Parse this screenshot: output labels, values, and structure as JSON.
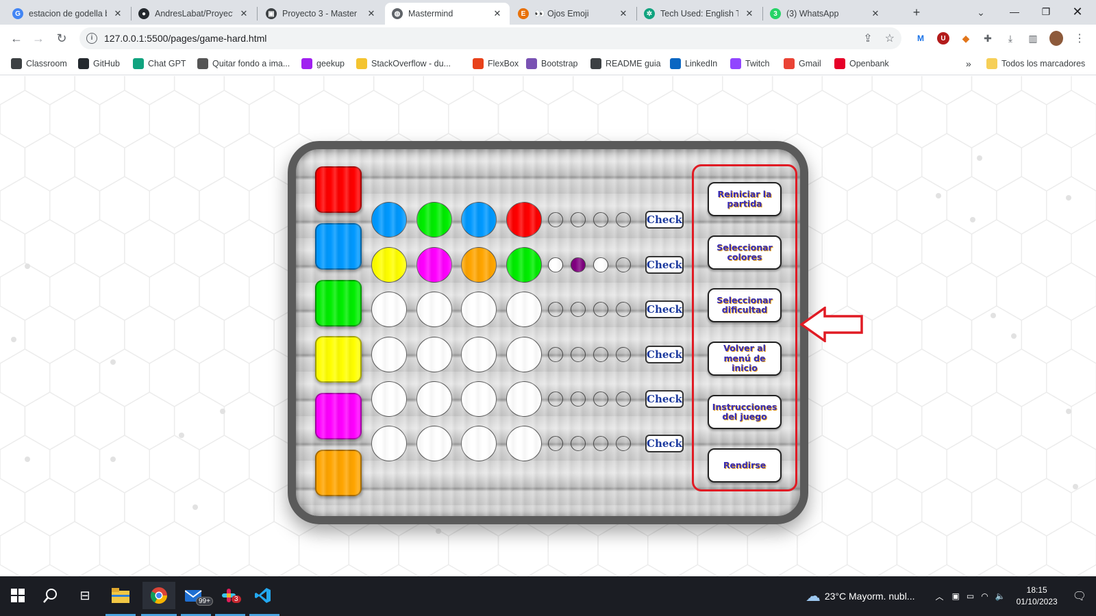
{
  "browser": {
    "tabs": [
      {
        "label": "estacion de godella b",
        "favicon": "google-icon",
        "color": "#4285f4",
        "glyph": "G"
      },
      {
        "label": "AndresLabat/Proyect",
        "favicon": "github-icon",
        "color": "#24292e",
        "glyph": "●"
      },
      {
        "label": "Proyecto 3 - Master",
        "favicon": "slides-icon",
        "color": "#3c4043",
        "glyph": "▣"
      },
      {
        "label": "Mastermind",
        "favicon": "globe-icon",
        "color": "#5f6368",
        "glyph": "◍"
      },
      {
        "label": "👀 Ojos Emoji",
        "favicon": "emojipedia-icon",
        "color": "#e8710a",
        "glyph": "E"
      },
      {
        "label": "Tech Used: English Tr",
        "favicon": "chatgpt-icon",
        "color": "#10a37f",
        "glyph": "✲"
      },
      {
        "label": "(3) WhatsApp",
        "favicon": "whatsapp-icon",
        "color": "#25d366",
        "glyph": "3"
      }
    ],
    "active_tab": 3,
    "url": "127.0.0.1:5500/pages/game-hard.html"
  },
  "bookmarks": [
    {
      "label": "Classroom",
      "icon": "classroom-icon",
      "color": "#3c4043"
    },
    {
      "label": "GitHub",
      "icon": "github-icon",
      "color": "#24292e"
    },
    {
      "label": "Chat GPT",
      "icon": "chatgpt-icon",
      "color": "#10a37f"
    },
    {
      "label": "Quitar fondo a ima...",
      "icon": "removebg-icon",
      "color": "#555555"
    },
    {
      "label": "geekup",
      "icon": "geekup-icon",
      "color": "#a020f0"
    },
    {
      "label": "StackOverflow - du...",
      "icon": "stackoverflow-icon",
      "color": "#f4c430"
    },
    {
      "label": "FlexBox",
      "icon": "flexbox-icon",
      "color": "#e8411a"
    },
    {
      "label": "Bootstrap",
      "icon": "bootstrap-icon",
      "color": "#7952b3"
    },
    {
      "label": "README guia",
      "icon": "markdown-icon",
      "color": "#3c4043"
    },
    {
      "label": "LinkedIn",
      "icon": "linkedin-icon",
      "color": "#0a66c2"
    },
    {
      "label": "Twitch",
      "icon": "twitch-icon",
      "color": "#9146ff"
    },
    {
      "label": "Gmail",
      "icon": "gmail-icon",
      "color": "#ea4335"
    },
    {
      "label": "Openbank",
      "icon": "openbank-icon",
      "color": "#e60028"
    }
  ],
  "bookmarks_overflow": "»",
  "bookmarks_folder": "Todos los marcadores",
  "game": {
    "palette": [
      "#ff0000",
      "#0099ff",
      "#00ee00",
      "#ffff00",
      "#ff00ff",
      "#ffa500"
    ],
    "rows": [
      {
        "pegs": [
          "#0099ff",
          "#00ee00",
          "#0099ff",
          "#ff0000"
        ],
        "keys": [
          "empty",
          "empty",
          "empty",
          "empty"
        ]
      },
      {
        "pegs": [
          "#ffff00",
          "#ff00ff",
          "#ffa500",
          "#00ee00"
        ],
        "keys": [
          "#ffffff",
          "#800080",
          "#ffffff",
          "empty"
        ]
      },
      {
        "pegs": [
          "#ffffff",
          "#ffffff",
          "#ffffff",
          "#ffffff"
        ],
        "keys": [
          "empty",
          "empty",
          "empty",
          "empty"
        ]
      },
      {
        "pegs": [
          "#ffffff",
          "#ffffff",
          "#ffffff",
          "#ffffff"
        ],
        "keys": [
          "empty",
          "empty",
          "empty",
          "empty"
        ]
      },
      {
        "pegs": [
          "#ffffff",
          "#ffffff",
          "#ffffff",
          "#ffffff"
        ],
        "keys": [
          "empty",
          "empty",
          "empty",
          "empty"
        ]
      },
      {
        "pegs": [
          "#ffffff",
          "#ffffff",
          "#ffffff",
          "#ffffff"
        ],
        "keys": [
          "empty",
          "empty",
          "empty",
          "empty"
        ]
      }
    ],
    "check_label": "Check",
    "menu": [
      {
        "name": "restart-game-button",
        "label": "Reiniciar la partida"
      },
      {
        "name": "select-colors-button",
        "label": "Seleccionar colores"
      },
      {
        "name": "select-difficulty-button",
        "label": "Seleccionar dificultad"
      },
      {
        "name": "back-to-menu-button",
        "label": "Volver al menú de inicio"
      },
      {
        "name": "instructions-button",
        "label": "Instrucciones del juego"
      },
      {
        "name": "surrender-button",
        "label": "Rendirse"
      }
    ],
    "highlight_color": "#e01b24"
  },
  "taskbar": {
    "weather": "23°C  Mayorm. nubl...",
    "time": "18:15",
    "date": "01/10/2023",
    "mail_badge": "99+",
    "slack_badge": "3"
  }
}
